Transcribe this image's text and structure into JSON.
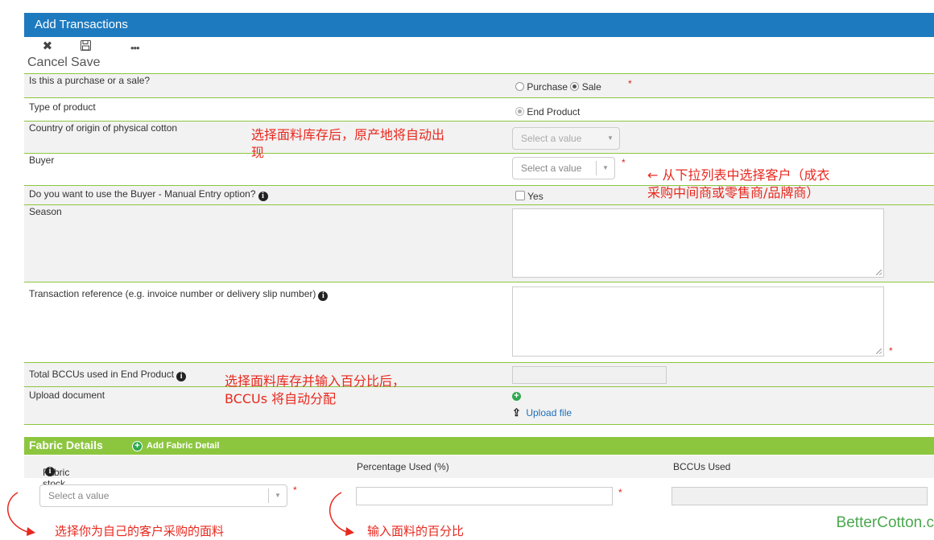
{
  "header": {
    "title": "Add Transactions"
  },
  "toolbar": {
    "cancel_label": "Cancel",
    "save_label": "Save",
    "more_label": "•••"
  },
  "form": {
    "purchase_or_sale": {
      "label": "Is this a purchase or a sale?",
      "option_purchase": "Purchase",
      "option_sale": "Sale",
      "selected": "Sale"
    },
    "type_of_product": {
      "label": "Type of product",
      "option": "End Product"
    },
    "country_of_origin": {
      "label": "Country of origin of physical cotton",
      "placeholder": "Select a value"
    },
    "buyer": {
      "label": "Buyer",
      "placeholder": "Select a value"
    },
    "buyer_manual": {
      "label": "Do you want to use the Buyer - Manual Entry option?",
      "option": "Yes"
    },
    "season": {
      "label": "Season"
    },
    "transaction_reference": {
      "label": "Transaction reference (e.g. invoice number or delivery slip number)"
    },
    "total_bccus": {
      "label": "Total BCCUs used in End Product"
    },
    "upload_document": {
      "label": "Upload document",
      "link": "Upload file"
    }
  },
  "fabric_details": {
    "title": "Fabric Details",
    "add_label": "Add Fabric Detail",
    "columns": [
      "Fabric stock",
      "Percentage Used (%)",
      "BCCUs Used"
    ],
    "fabric_stock_placeholder": "Select a value"
  },
  "required_mark": "*",
  "annotations": {
    "country_note_line1": "选择面料库存后，原产地将自动出",
    "country_note_line2": "现",
    "buyer_note_line1": "← 从下拉列表中选择客户（成衣",
    "buyer_note_line2": "采购中间商或零售商/品牌商）",
    "bccu_note_line1": "选择面料库存并输入百分比后，",
    "bccu_note_line2": "BCCUs 将自动分配",
    "fabric_stock_note": "选择你为自己的客户采购的面料",
    "percentage_note": "输入面料的百分比"
  },
  "brand": "BetterCotton.c",
  "colors": {
    "header_blue": "#1e7abf",
    "accent_green": "#8cc63f",
    "annotation_red": "#e8281e",
    "brand_green": "#4aa84e"
  }
}
